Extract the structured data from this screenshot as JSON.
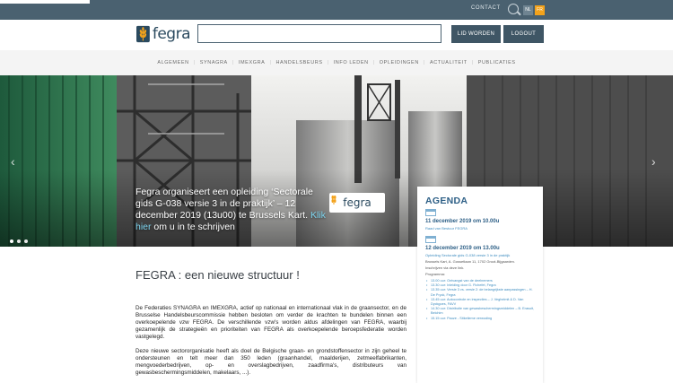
{
  "topbar": {
    "contact_label": "CONTACT",
    "lang_nl": "NL",
    "lang_fr": "FR"
  },
  "header": {
    "logo_text": "fegra",
    "search_placeholder": "",
    "lid_worden_label": "LID WORDEN",
    "logout_label": "LOGOUT"
  },
  "nav": {
    "items": [
      "ALGEMEEN",
      "SYNAGRA",
      "IMEXGRA",
      "HANDELSBEURS",
      "INFO LEDEN",
      "OPLEIDINGEN",
      "ACTUALITEIT",
      "PUBLICATIES"
    ]
  },
  "hero": {
    "caption_text": "Fegra organiseert een opleiding ‘Sectorale gids G-038 versie 3 in de praktijk’ – 12 december 2019 (13u00) te Brussels Kart. ",
    "caption_link": "Klik hier",
    "caption_tail": " om u in te schrijven",
    "logo_text": "fegra",
    "prev_arrow": "‹",
    "next_arrow": "›"
  },
  "agenda": {
    "title": "AGENDA",
    "event1": {
      "date": "11 december 2019 om 10.00u",
      "link": "Raad van Bestuur FEGRA"
    },
    "event2": {
      "date": "12 december 2019 om 13.00u",
      "link": "Opleiding Sectorale gids G-038 versie 3 in de praktijk",
      "location": "Brussels Kart, A. Gossetlaan 11, 1702 Groot-Bijgaarden.",
      "register": "Inschrijven via deze link.",
      "program_label": "Programma:",
      "program": [
        "13.00 uur: Ontvangst van de deelnemers",
        "13.30 uur: Inleiding door G. Fichefet, Fegra",
        "13.35 uur: Versie 3 vs. versie 2: de belangrijkste aanpassingen – H. De Pryck, Fegra",
        "13.45 uur: Autocontrole en inspecties – J. Veghelmit & D. Van Dyckgoes, FAVV",
        "14.30 uur: Distributie van gewasbeschermingsmiddelen – B. Erasuit, Belchim",
        "15.15 uur: Pauze - Sitkelieme verwoding"
      ]
    }
  },
  "main": {
    "title": "FEGRA : een nieuwe structuur !",
    "paragraph1": "De Federaties SYNAGRA en IMEXGRA, actief op nationaal en internationaal vlak in de graansector, en de Brusselse Handelsbeurscommissie hebben besloten om verder de krachten te bundelen binnen een overkoepelende vzw FEGRA. De verschillende vzw's worden aldus afdelingen van FEGRA, waarbij gezamenlijk de strategieën en prioriteiten van FEGRA als overkoepelende beroepsfederatie worden vastgelegd.",
    "paragraph2": "Deze nieuwe sectororganisatie heeft als doel de Belgische graan- en grondstoffensector in zijn geheel te ondersteunen en telt meer dan 350 leden (graanhandel, maalderijen, zetmeelfabrikanten, mengvoederbedrijven, op- en overslagbedrijven, zaadfirma's, distributeurs van gewasbeschermingsmiddelen, makelaars, ...)."
  },
  "colors": {
    "topbar": "#4a6170",
    "accent_orange": "#f3a21b",
    "agenda_blue": "#2d5f86"
  }
}
